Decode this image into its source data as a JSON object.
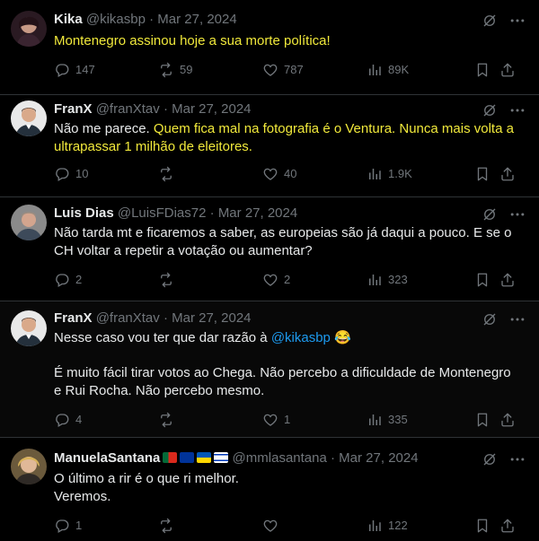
{
  "tweets": [
    {
      "name": "Kika",
      "handle": "@kikasbp",
      "date": "Mar 27, 2024",
      "text": "Montenegro assinou hoje a sua morte política!",
      "replies": "147",
      "reposts": "59",
      "likes": "787",
      "views": "89K"
    },
    {
      "name": "FranX",
      "handle": "@franXtav",
      "date": "Mar 27, 2024",
      "text_plain": "Não me parece. ",
      "text_highlight": "Quem fica mal na fotografia é o Ventura. Nunca mais volta a ultrapassar 1 milhão de eleitores.",
      "replies": "10",
      "reposts": "",
      "likes": "40",
      "views": "1.9K"
    },
    {
      "name": "Luis Dias",
      "handle": "@LuisFDias72",
      "date": "Mar 27, 2024",
      "text": "Não tarda mt e ficaremos a saber, as europeias são já daqui a pouco. E se o CH voltar a repetir a votação ou aumentar?",
      "replies": "2",
      "reposts": "",
      "likes": "2",
      "views": "323"
    },
    {
      "name": "FranX",
      "handle": "@franXtav",
      "date": "Mar 27, 2024",
      "text_before": "Nesse caso vou ter que dar razão à ",
      "mention": "@kikasbp",
      "emoji": "😂",
      "text_after": "É muito fácil tirar votos ao Chega. Não percebo a dificuldade de Montenegro e Rui Rocha. Não percebo mesmo.",
      "replies": "4",
      "reposts": "",
      "likes": "1",
      "views": "335"
    },
    {
      "name": "ManuelaSantana",
      "handle": "@mmlasantana",
      "date": "Mar 27, 2024",
      "text": "O último a rir é o que ri melhor.\nVeremos.",
      "replies": "1",
      "reposts": "",
      "likes": "",
      "views": "122"
    }
  ],
  "colors": {
    "background": "#000000",
    "highlight_text": "#f1e93b",
    "mention": "#1d9bf0",
    "muted": "#71767b"
  },
  "icons": [
    "grok-icon",
    "more-icon",
    "reply-icon",
    "repost-icon",
    "like-icon",
    "views-icon",
    "bookmark-icon",
    "share-icon"
  ]
}
